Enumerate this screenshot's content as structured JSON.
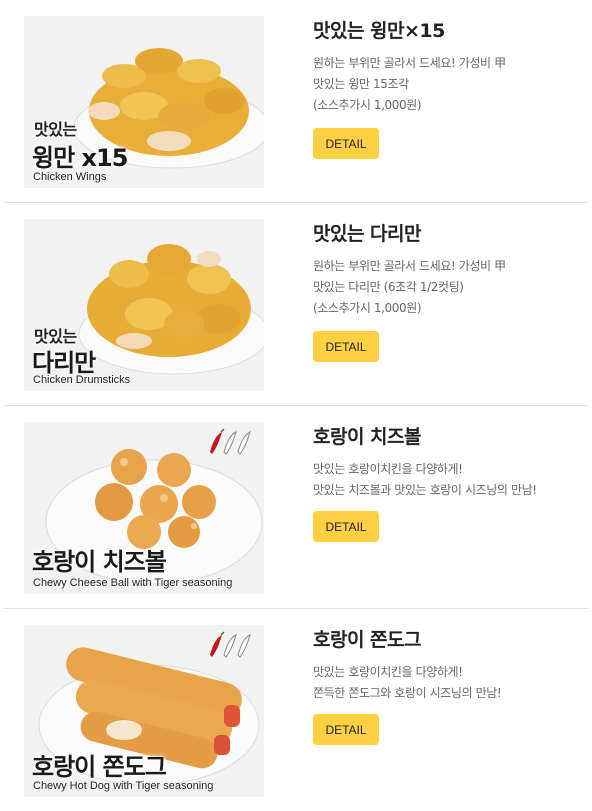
{
  "menu": [
    {
      "name": "맛있는 윙만×15",
      "desc": [
        "원하는 부위만 골라서 드세요! 가성비 甲",
        "맛있는 윙만 15조각",
        "(소스추가시 1,000원)"
      ],
      "thumb": {
        "small": "맛있는",
        "big": "윙만 x15",
        "english": "Chicken Wings"
      },
      "button": "DETAIL"
    },
    {
      "name": "맛있는 다리만",
      "desc": [
        "원하는 부위만 골라서 드세요! 가성비 甲",
        "맛있는 다리만 (6조각 1/2컷팅)",
        "(소스추가시 1,000원)"
      ],
      "thumb": {
        "small": "맛있는",
        "big": "다리만",
        "english": "Chicken Drumsticks"
      },
      "button": "DETAIL"
    },
    {
      "name": "호랑이 치즈볼",
      "desc": [
        "맛있는 호랑이치킨을 다양하게!",
        "맛있는 치즈볼과 맛있는 호랑이 시즈닝의 만남!"
      ],
      "thumb": {
        "big": "호랑이 치즈볼",
        "english": "Chewy Cheese Ball with Tiger seasoning"
      },
      "button": "DETAIL"
    },
    {
      "name": "호랑이 쫀도그",
      "desc": [
        "맛있는 호랑이치킨을 다양하게!",
        "쫀득한 쫀도그와 호랑이 시즈닝의 만남!"
      ],
      "thumb": {
        "big": "호랑이 쫀도그",
        "english": "Chewy Hot Dog with Tiger seasoning"
      },
      "button": "DETAIL"
    }
  ],
  "colors": {
    "button": "#ffd041",
    "divider": "#e2e2e2",
    "chicken": "#e9b23a",
    "pepper": "#c8151b"
  }
}
